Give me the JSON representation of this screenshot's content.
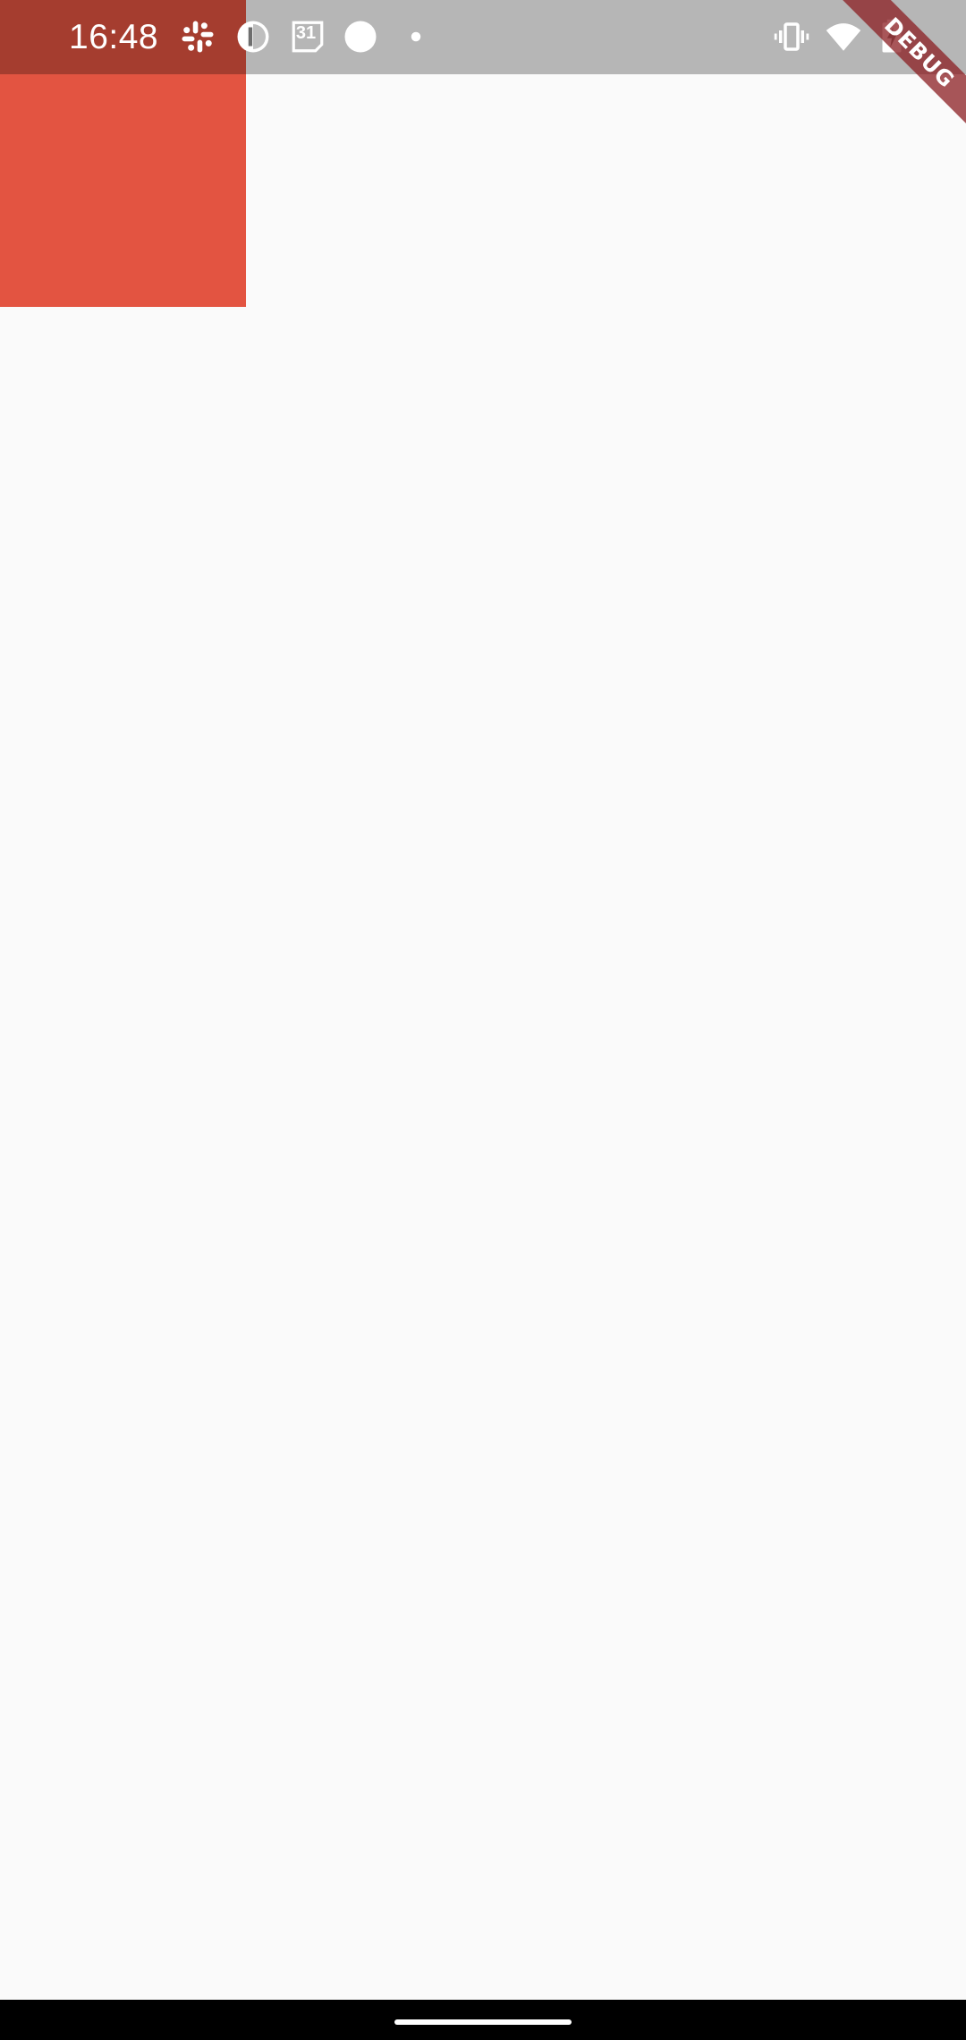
{
  "status_bar": {
    "time": "16:48",
    "notification_icons": [
      "slack-icon",
      "half-circle-icon",
      "calendar-icon",
      "circle-icon",
      "dot-icon"
    ],
    "calendar_day": "31",
    "system_icons": [
      "vibrate-icon",
      "wifi-icon",
      "battery-charging-icon"
    ]
  },
  "debug_banner": {
    "label": "DEBUG"
  },
  "colors": {
    "red_box": "#e35441",
    "background": "#fafafa"
  }
}
